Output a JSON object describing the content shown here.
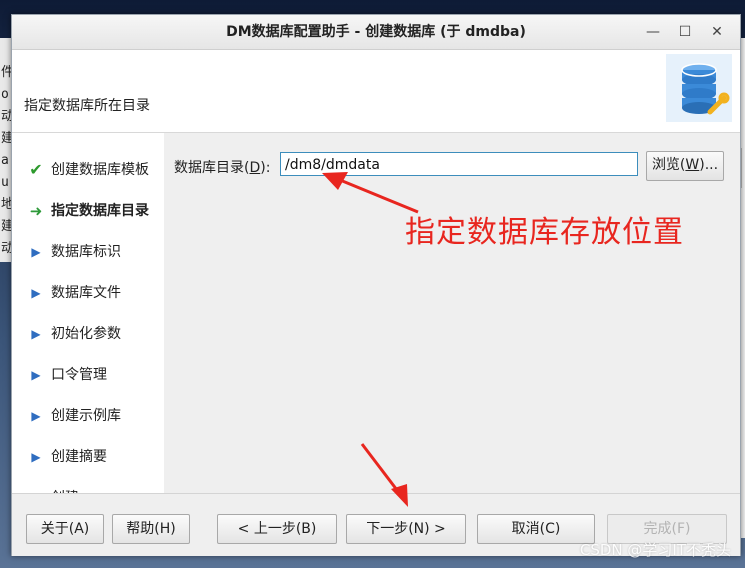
{
  "desktop": {
    "bg_window_chars": [
      "件",
      "o",
      "动",
      "建",
      "a",
      "u",
      "地",
      "建",
      "动",
      "o"
    ]
  },
  "dialog": {
    "title": "DM数据库配置助手 - 创建数据库 (于 dmdba)",
    "controls": {
      "minimize": "—",
      "maximize": "☐",
      "close": "✕"
    }
  },
  "header": {
    "heading": "指定数据库所在目录",
    "logo_icon": "database-wrench-icon"
  },
  "steps": [
    {
      "label": "创建数据库模板",
      "state": "done",
      "icon": "✔"
    },
    {
      "label": "指定数据库目录",
      "state": "current",
      "icon": "➜"
    },
    {
      "label": "数据库标识",
      "state": "todo",
      "icon": "▶"
    },
    {
      "label": "数据库文件",
      "state": "todo",
      "icon": "▶"
    },
    {
      "label": "初始化参数",
      "state": "todo",
      "icon": "▶"
    },
    {
      "label": "口令管理",
      "state": "todo",
      "icon": "▶"
    },
    {
      "label": "创建示例库",
      "state": "todo",
      "icon": "▶"
    },
    {
      "label": "创建摘要",
      "state": "todo",
      "icon": "▶"
    },
    {
      "label": "创建",
      "state": "todo",
      "icon": "▶"
    }
  ],
  "form": {
    "dir_label_pre": "数据库目录(",
    "dir_label_key": "D",
    "dir_label_post": "):",
    "dir_value": "/dm8/dmdata",
    "browse_pre": "浏览(",
    "browse_key": "W",
    "browse_post": ")..."
  },
  "annotation": {
    "text": "指定数据库存放位置",
    "color": "#e8261f"
  },
  "footer": {
    "about": "关于(A)",
    "help": "帮助(H)",
    "prev": "< 上一步(B)",
    "next": "下一步(N) >",
    "cancel": "取消(C)",
    "finish": "完成(F)"
  },
  "watermark": "CSDN @学习IT不秃头"
}
